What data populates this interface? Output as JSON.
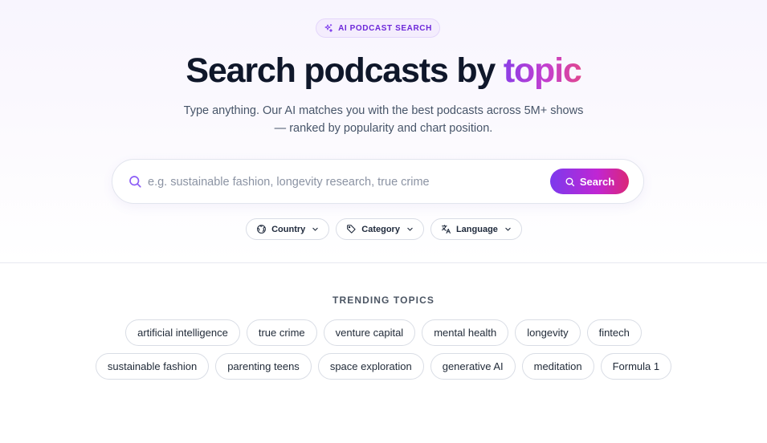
{
  "badge": {
    "label": "AI PODCAST SEARCH",
    "icon": "sparkles-icon"
  },
  "hero": {
    "title_main": "Search podcasts by ",
    "title_accent": "topic",
    "subtitle_line1": "Type anything. Our AI matches you with the best podcasts across 5M+ shows",
    "subtitle_line2": "— ranked by popularity and chart position."
  },
  "search": {
    "placeholder": "e.g. sustainable fashion, longevity research, true crime",
    "value": "",
    "button_label": "Search"
  },
  "filters": [
    {
      "label": "Country",
      "icon": "globe-icon"
    },
    {
      "label": "Category",
      "icon": "tag-icon"
    },
    {
      "label": "Language",
      "icon": "translate-icon"
    }
  ],
  "trending": {
    "title": "TRENDING TOPICS",
    "topics": [
      "artificial intelligence",
      "true crime",
      "venture capital",
      "mental health",
      "longevity",
      "fintech",
      "sustainable fashion",
      "parenting teens",
      "space exploration",
      "generative AI",
      "meditation",
      "Formula 1"
    ]
  },
  "colors": {
    "accent_start": "#7c3aed",
    "accent_mid": "#c026d3",
    "accent_end": "#db2777",
    "text": "#0f172a",
    "muted": "#475569"
  }
}
